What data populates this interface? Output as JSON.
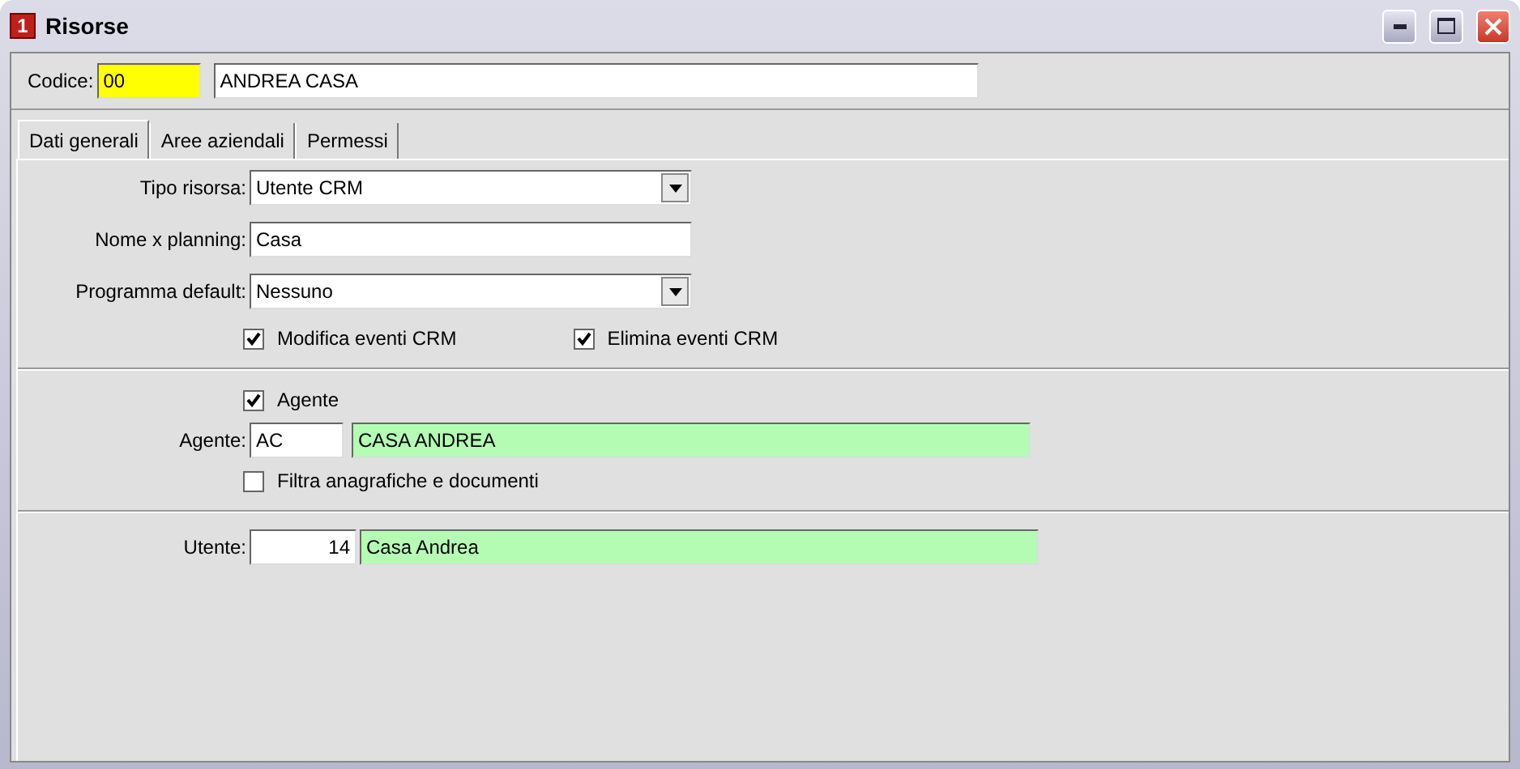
{
  "window": {
    "title": "Risorse",
    "icon_text": "1"
  },
  "header": {
    "label": "Codice:",
    "code": "00",
    "name": "ANDREA CASA"
  },
  "tabs": [
    {
      "label": "Dati generali",
      "selected": true
    },
    {
      "label": "Aree aziendali",
      "selected": false
    },
    {
      "label": "Permessi",
      "selected": false
    }
  ],
  "general": {
    "tipo": {
      "label": "Tipo risorsa:",
      "value": "Utente CRM"
    },
    "nome": {
      "label": "Nome x planning:",
      "value": "Casa"
    },
    "programma": {
      "label": "Programma default:",
      "value": "Nessuno"
    },
    "options": [
      {
        "label": "Modifica eventi CRM",
        "checked": true
      },
      {
        "label": "Elimina eventi CRM",
        "checked": true
      }
    ]
  },
  "agent": {
    "enabled": {
      "label": "Agente",
      "checked": true
    },
    "label": "Agente:",
    "code": "AC",
    "name": "CASA ANDREA",
    "filter": {
      "label": "Filtra anagrafiche e documenti",
      "checked": false
    }
  },
  "user": {
    "label": "Utente:",
    "number": "14",
    "name": "Casa Andrea"
  }
}
